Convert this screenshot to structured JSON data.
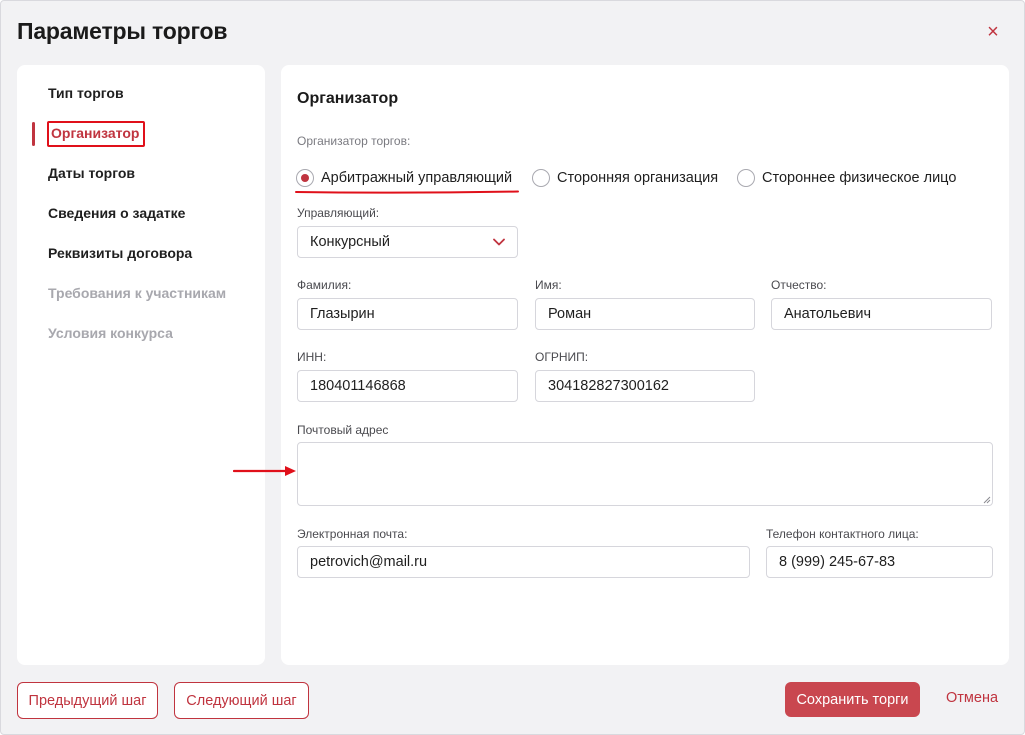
{
  "modal": {
    "title": "Параметры торгов",
    "close_symbol": "×"
  },
  "sidebar": {
    "items": [
      {
        "label": "Тип торгов",
        "state": "done"
      },
      {
        "label": "Организатор",
        "state": "active"
      },
      {
        "label": "Даты торгов",
        "state": "done"
      },
      {
        "label": "Сведения о задатке",
        "state": "done"
      },
      {
        "label": "Реквизиты договора",
        "state": "done"
      },
      {
        "label": "Требования к участникам",
        "state": "disabled"
      },
      {
        "label": "Условия конкурса",
        "state": "disabled"
      }
    ]
  },
  "form": {
    "section_title": "Организатор",
    "organizer_label": "Организатор торгов:",
    "organizer_options": [
      {
        "label": "Арбитражный управляющий",
        "checked": true
      },
      {
        "label": "Сторонняя организация",
        "checked": false
      },
      {
        "label": "Стороннее физическое лицо",
        "checked": false
      }
    ],
    "manager": {
      "label": "Управляющий:",
      "value": "Конкурсный"
    },
    "last_name": {
      "label": "Фамилия:",
      "value": "Глазырин"
    },
    "first_name": {
      "label": "Имя:",
      "value": "Роман"
    },
    "middle_name": {
      "label": "Отчество:",
      "value": "Анатольевич"
    },
    "inn": {
      "label": "ИНН:",
      "value": "180401146868"
    },
    "ogrnip": {
      "label": "ОГРНИП:",
      "value": "304182827300162"
    },
    "postal_address": {
      "label": "Почтовый адрес",
      "value": ""
    },
    "email": {
      "label": "Электронная почта:",
      "value": "petrovich@mail.ru"
    },
    "phone": {
      "label": "Телефон контактного лица:",
      "value": "8 (999) 245-67-83"
    }
  },
  "footer": {
    "prev_label": "Предыдущий шаг",
    "next_label": "Следующий шаг",
    "save_label": "Сохранить торги",
    "cancel_label": "Отмена"
  },
  "colors": {
    "accent": "#c0343f",
    "primary_button": "#c9474f",
    "annotation": "#e0101a",
    "background": "#f2f2f4"
  }
}
